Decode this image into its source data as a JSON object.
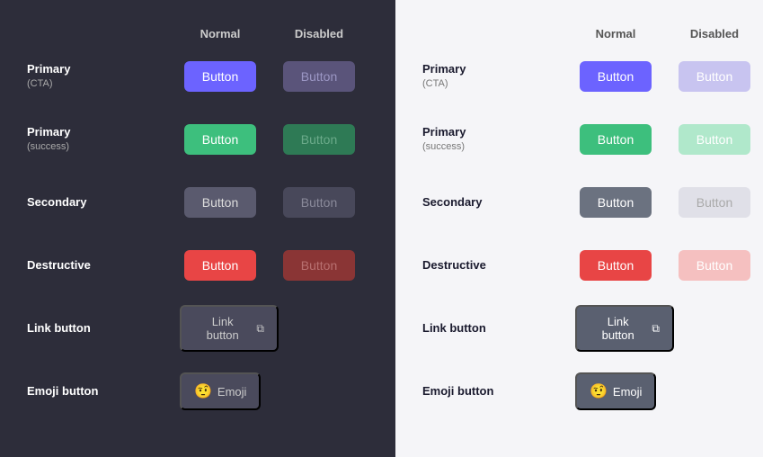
{
  "left": {
    "background": "dark",
    "columns": {
      "label": "",
      "normal": "Normal",
      "disabled": "Disabled"
    },
    "rows": [
      {
        "id": "primary-cta",
        "label": "Primary",
        "sublabel": "(CTA)",
        "normal_label": "Button",
        "disabled_label": "Button",
        "type": "primary-cta"
      },
      {
        "id": "primary-success",
        "label": "Primary",
        "sublabel": "(success)",
        "normal_label": "Button",
        "disabled_label": "Button",
        "type": "primary-success"
      },
      {
        "id": "secondary",
        "label": "Secondary",
        "sublabel": "",
        "normal_label": "Button",
        "disabled_label": "Button",
        "type": "secondary"
      },
      {
        "id": "destructive",
        "label": "Destructive",
        "sublabel": "",
        "normal_label": "Button",
        "disabled_label": "Button",
        "type": "destructive"
      },
      {
        "id": "link",
        "label": "Link button",
        "sublabel": "",
        "normal_label": "Link button",
        "type": "link"
      },
      {
        "id": "emoji",
        "label": "Emoji button",
        "sublabel": "",
        "normal_label": "Emoji",
        "type": "emoji"
      }
    ]
  },
  "right": {
    "background": "light",
    "columns": {
      "label": "",
      "normal": "Normal",
      "disabled": "Disabled"
    },
    "rows": [
      {
        "id": "primary-cta",
        "label": "Primary",
        "sublabel": "(CTA)",
        "normal_label": "Button",
        "disabled_label": "Button",
        "type": "primary-cta"
      },
      {
        "id": "primary-success",
        "label": "Primary",
        "sublabel": "(success)",
        "normal_label": "Button",
        "disabled_label": "Button",
        "type": "primary-success"
      },
      {
        "id": "secondary",
        "label": "Secondary",
        "sublabel": "",
        "normal_label": "Button",
        "disabled_label": "Button",
        "type": "secondary"
      },
      {
        "id": "destructive",
        "label": "Destructive",
        "sublabel": "",
        "normal_label": "Button",
        "disabled_label": "Button",
        "type": "destructive"
      },
      {
        "id": "link",
        "label": "Link button",
        "sublabel": "",
        "normal_label": "Link button",
        "type": "link"
      },
      {
        "id": "emoji",
        "label": "Emoji button",
        "sublabel": "",
        "normal_label": "Emoji",
        "type": "emoji"
      }
    ]
  }
}
